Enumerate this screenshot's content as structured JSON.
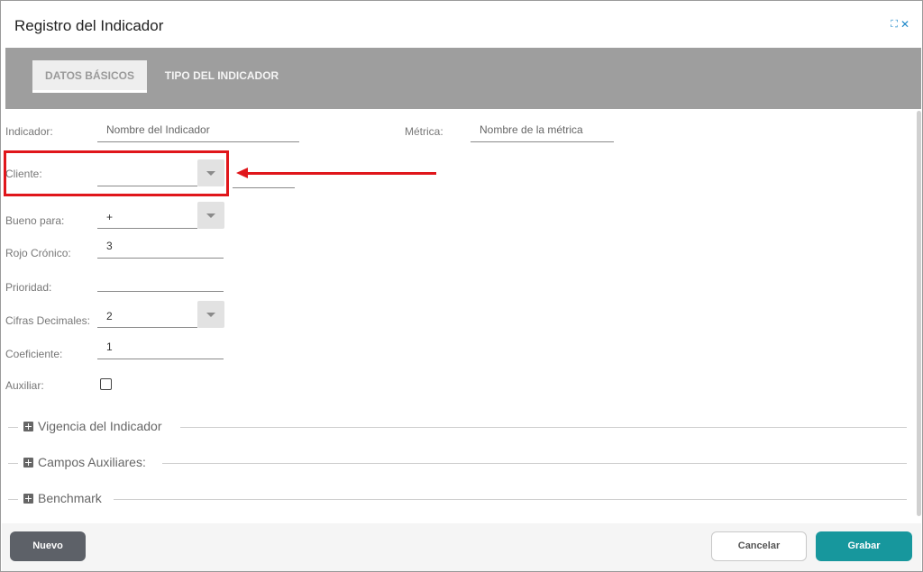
{
  "dialog": {
    "title": "Registro del Indicador",
    "expand_icon": "expand-icon",
    "close_icon": "close-icon",
    "expand_glyph": "⛶",
    "close_glyph": "✕"
  },
  "tabs": [
    {
      "label": "DATOS BÁSICOS",
      "active": true
    },
    {
      "label": "TIPO DEL INDICADOR",
      "active": false
    }
  ],
  "form": {
    "indicador": {
      "label": "Indicador:",
      "placeholder": "Nombre del Indicador"
    },
    "metrica": {
      "label": "Métrica:",
      "placeholder": "Nombre de la métrica"
    },
    "cliente": {
      "label": "Cliente:",
      "value": ""
    },
    "bueno_para": {
      "label": "Bueno para:",
      "value": "+"
    },
    "rojo_cronico": {
      "label": "Rojo Crónico:",
      "value": "3"
    },
    "prioridad": {
      "label": "Prioridad:",
      "value": ""
    },
    "cifras_decimales": {
      "label": "Cifras Decimales:",
      "value": "2"
    },
    "coeficiente": {
      "label": "Coeficiente:",
      "value": "1"
    },
    "auxiliar": {
      "label": "Auxiliar:",
      "checked": false
    }
  },
  "sections": [
    {
      "title": "Vigencia del Indicador",
      "icon": "plus-square-icon"
    },
    {
      "title": "Campos Auxiliares:",
      "icon": "plus-square-icon"
    },
    {
      "title": "Benchmark",
      "icon": "plus-square-icon"
    }
  ],
  "footer": {
    "nuevo": "Nuevo",
    "cancelar": "Cancelar",
    "grabar": "Grabar"
  },
  "colors": {
    "tabbar": "#9e9e9e",
    "highlight": "#e0161b",
    "primary": "#17979d",
    "nuevo": "#5d6168",
    "icon": "#1e88c9"
  }
}
